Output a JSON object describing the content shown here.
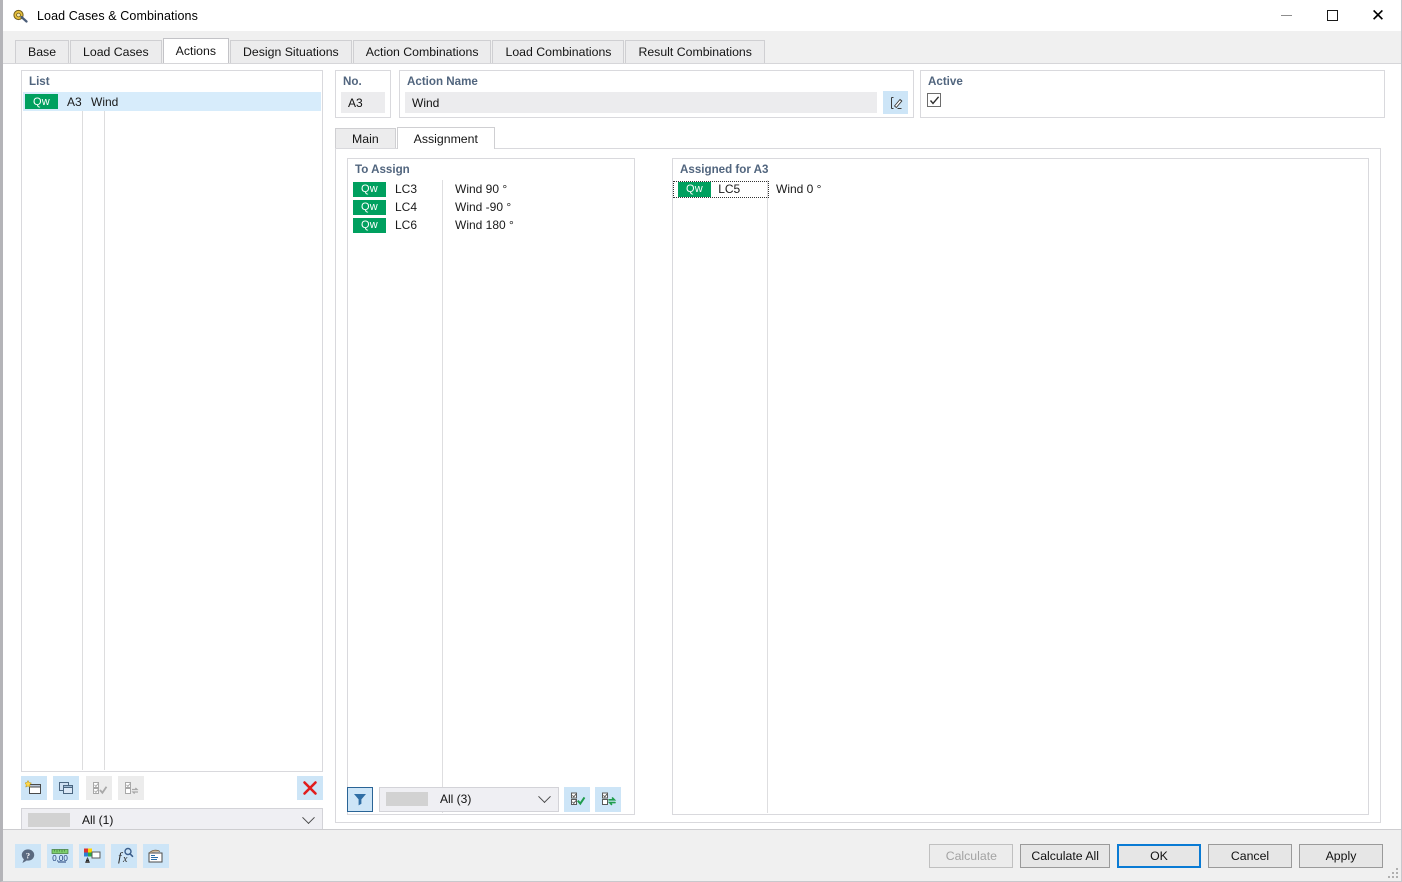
{
  "window": {
    "title": "Load Cases & Combinations",
    "icon": "app-icon",
    "minimize": "minimize-icon",
    "maximize": "maximize-icon",
    "close": "close-icon"
  },
  "tabs": [
    {
      "label": "Base",
      "active": false
    },
    {
      "label": "Load Cases",
      "active": false
    },
    {
      "label": "Actions",
      "active": true
    },
    {
      "label": "Design Situations",
      "active": false
    },
    {
      "label": "Action Combinations",
      "active": false
    },
    {
      "label": "Load Combinations",
      "active": false
    },
    {
      "label": "Result Combinations",
      "active": false
    }
  ],
  "list_panel": {
    "label": "List",
    "rows": [
      {
        "badge": "Qw",
        "no": "A3",
        "name": "Wind",
        "selected": true
      }
    ],
    "toolbar": [
      {
        "name": "new-action-button",
        "icon": "new-window-icon",
        "enabled": true
      },
      {
        "name": "duplicate-action-button",
        "icon": "copy-window-icon",
        "enabled": true
      },
      {
        "name": "select-all-button",
        "icon": "checkbox-check-icon",
        "enabled": false
      },
      {
        "name": "invert-selection-button",
        "icon": "checkbox-swap-icon",
        "enabled": false
      },
      {
        "name": "delete-action-button",
        "icon": "red-x-icon",
        "enabled": true
      }
    ],
    "filter": {
      "value": "All (1)",
      "chevron": "chevron-down-icon"
    }
  },
  "fields": {
    "no_label": "No.",
    "no_value": "A3",
    "name_label": "Action Name",
    "name_value": "Wind",
    "edit_icon": "pencil-edit-icon",
    "active_label": "Active",
    "active_checked": true
  },
  "subtabs": [
    {
      "label": "Main",
      "active": false
    },
    {
      "label": "Assignment",
      "active": true
    }
  ],
  "assignment": {
    "to_assign": {
      "label": "To Assign",
      "rows": [
        {
          "badge": "Qw",
          "id": "LC3",
          "desc": "Wind 90 °"
        },
        {
          "badge": "Qw",
          "id": "LC4",
          "desc": "Wind -90 °"
        },
        {
          "badge": "Qw",
          "id": "LC6",
          "desc": "Wind 180 °"
        }
      ]
    },
    "assigned": {
      "label": "Assigned for A3",
      "rows": [
        {
          "badge": "Qw",
          "id": "LC5",
          "desc": "Wind 0 °",
          "focused": true
        }
      ]
    },
    "transfer_buttons": [
      {
        "name": "assign-one-button",
        "icon": "arrow-right-icon",
        "enabled": false
      },
      {
        "name": "assign-all-button",
        "icon": "double-arrow-right-icon",
        "enabled": true
      },
      {
        "name": "unassign-one-button",
        "icon": "arrow-left-icon",
        "enabled": false
      },
      {
        "name": "unassign-all-button",
        "icon": "double-arrow-left-icon",
        "enabled": true
      }
    ],
    "filter_bar": {
      "funnel_icon": "filter-funnel-icon",
      "combo_value": "All (3)",
      "chevron": "chevron-down-icon",
      "select_all_icon": "checkbox-check-icon",
      "invert_selection_icon": "checkbox-swap-icon"
    }
  },
  "footer": {
    "icons": [
      {
        "name": "help-button",
        "icon": "help-bubble-icon"
      },
      {
        "name": "units-button",
        "icon": "units-0-00-icon"
      },
      {
        "name": "display-properties-button",
        "icon": "color-palette-icon"
      },
      {
        "name": "formula-button",
        "icon": "fx-icon"
      },
      {
        "name": "settings-button",
        "icon": "printer-settings-icon"
      }
    ],
    "buttons": [
      {
        "label": "Calculate",
        "name": "calculate-button",
        "enabled": false,
        "default": false
      },
      {
        "label": "Calculate All",
        "name": "calculate-all-button",
        "enabled": true,
        "default": false
      },
      {
        "label": "OK",
        "name": "ok-button",
        "enabled": true,
        "default": true
      },
      {
        "label": "Cancel",
        "name": "cancel-button",
        "enabled": true,
        "default": false
      },
      {
        "label": "Apply",
        "name": "apply-button",
        "enabled": true,
        "default": false
      }
    ]
  },
  "colors": {
    "badge_green": "#00a05f",
    "selection_blue": "#d7ecfb",
    "accent_blue": "#0a7bd4",
    "label_blue": "#51657e",
    "arrow_red": "#e05a5a",
    "delete_red": "#e11d1d"
  }
}
